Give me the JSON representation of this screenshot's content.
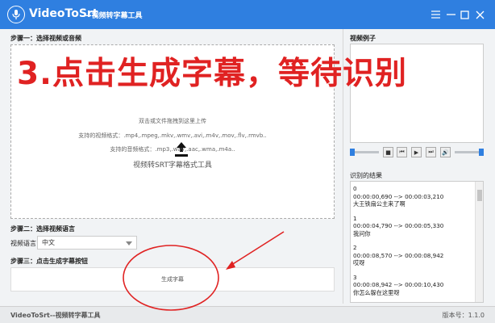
{
  "app": {
    "title": "VideoToSrt",
    "subtitle": "--视频转字幕工具"
  },
  "steps": {
    "step1": "步骤一：选择视频或音频",
    "step2": "步骤二：选择视频语言",
    "step3": "步骤三：点击生成字幕按钮"
  },
  "dropzone": {
    "hint": "双击或文件拖拽到这里上传",
    "video_formats": "支持的视频格式：.mp4,.mpeg,.mkv,.wmv,.avi,.m4v,.mov,.flv,.rmvb..",
    "audio_formats": "支持的音频格式：.mp3,.wav,.aac,.wma,.m4a..",
    "description": "视频转SRT字幕格式工具"
  },
  "language": {
    "label": "视频语言",
    "selected": "中文"
  },
  "generate_button": "生成字幕",
  "video_example": {
    "label": "视频例子"
  },
  "player": {
    "buttons": [
      "■",
      "⏮",
      "▶",
      "⏭",
      "🔊"
    ]
  },
  "results": {
    "label": "识别的结果",
    "entries": [
      {
        "index": "0",
        "time": "00:00:00,690 --> 00:00:03,210",
        "text": "大王铁扇公主来了啊"
      },
      {
        "index": "1",
        "time": "00:00:04,790 --> 00:00:05,330",
        "text": "我问你"
      },
      {
        "index": "2",
        "time": "00:00:08,570 --> 00:00:08,942",
        "text": "哎呀"
      },
      {
        "index": "3",
        "time": "00:00:08,942 --> 00:00:10,430",
        "text": "你怎么躲在这里呀"
      }
    ]
  },
  "footer": {
    "app": "VideoToSrt--视频转字幕工具",
    "version": "版本号：1.1.0"
  },
  "overlay": {
    "instruction": "3.点击生成字幕，等待识别"
  },
  "colors": {
    "titlebar": "#2f7fe0",
    "annotation": "#e02222"
  }
}
